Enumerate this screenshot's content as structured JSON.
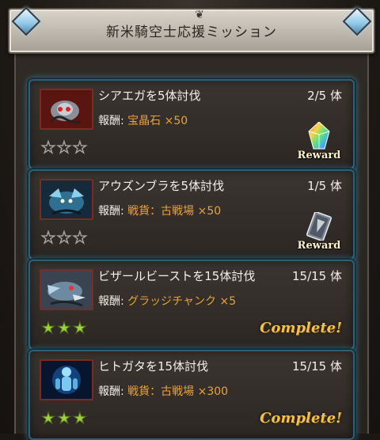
{
  "header": {
    "title": "新米騎空士応援ミッション"
  },
  "missions": [
    {
      "title": "シアエガを5体討伐",
      "progress": "2/5 体",
      "reward_prefix": "報酬: ",
      "reward_value": "宝晶石 ×50",
      "stars": [
        "empty",
        "empty",
        "empty"
      ],
      "action_label": "Reward",
      "action_icon": "crystal-icon"
    },
    {
      "title": "アウズンブラを5体討伐",
      "progress": "1/5 体",
      "reward_prefix": "報酬: ",
      "reward_value": "戦貨：古戦場 ×50",
      "stars": [
        "empty",
        "empty",
        "empty"
      ],
      "action_label": "Reward",
      "action_icon": "medal-card-icon"
    },
    {
      "title": "ビザールビーストを15体討伐",
      "progress": "15/15 体",
      "reward_prefix": "報酬: ",
      "reward_value": "グラッジチャンク ×5",
      "stars": [
        "full",
        "full",
        "full"
      ],
      "action_label": "Complete!"
    },
    {
      "title": "ヒトガタを15体討伐",
      "progress": "15/15 体",
      "reward_prefix": "報酬: ",
      "reward_value": "戦貨：古戦場 ×300",
      "stars": [
        "full",
        "full",
        "full"
      ],
      "action_label": "Complete!"
    }
  ],
  "colors": {
    "accent_glow": "#5abeeb",
    "reward_text": "#e8a23a",
    "complete_text": "#f1c24a",
    "star_full": "#9fd23c"
  }
}
